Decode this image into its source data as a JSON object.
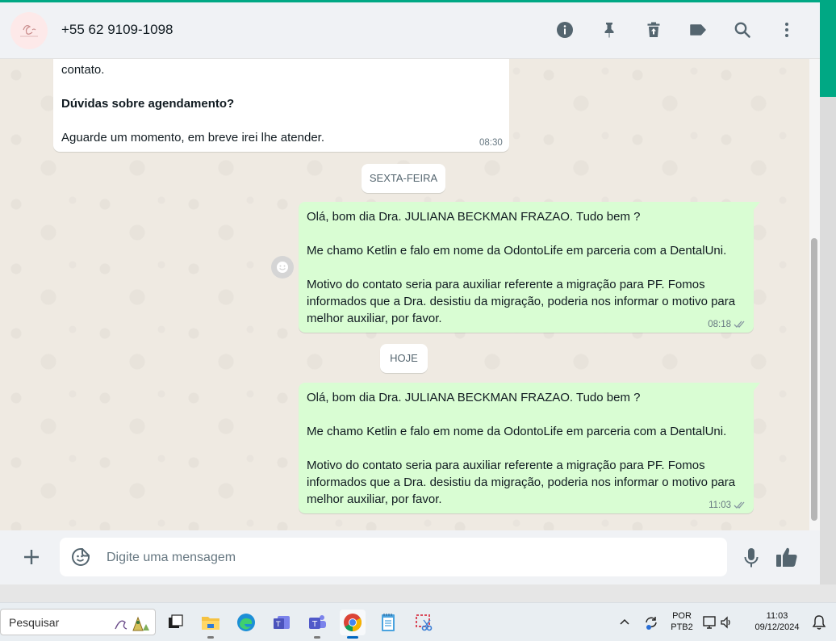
{
  "header": {
    "contact_name": "+55 62 9109-1098",
    "icons": [
      "info-icon",
      "pin-icon",
      "delete-icon",
      "label-icon",
      "search-icon",
      "menu-icon"
    ]
  },
  "messages": {
    "incoming_partial": {
      "line1": "contato.",
      "line2": "Dúvidas sobre agendamento?",
      "line3": "Aguarde um momento, em breve irei lhe atender.",
      "time": "08:30"
    },
    "date_friday": "SEXTA-FEIRA",
    "outgoing_1": {
      "p1": "Olá, bom dia Dra. JULIANA BECKMAN FRAZAO. Tudo bem ?",
      "p2": "Me chamo Ketlin e falo em nome da OdontoLife em parceria com a DentalUni.",
      "p3": "Motivo do contato seria para auxiliar referente a migração para PF. Fomos informados que a Dra. desistiu da migração, poderia nos informar o motivo para melhor auxiliar, por favor.",
      "time": "08:18"
    },
    "date_today": "HOJE",
    "outgoing_2": {
      "p1": "Olá, bom dia Dra. JULIANA BECKMAN FRAZAO. Tudo bem ?",
      "p2": "Me chamo Ketlin e falo em nome da OdontoLife em parceria com a DentalUni.",
      "p3": "Motivo do contato seria para auxiliar referente a migração para PF. Fomos informados que a Dra. desistiu da migração, poderia nos informar o motivo para melhor auxiliar, por favor.",
      "time": "11:03"
    }
  },
  "composer": {
    "placeholder": "Digite uma mensagem",
    "value": ""
  },
  "taskbar": {
    "search_label": "Pesquisar",
    "language_line1": "POR",
    "language_line2": "PTB2",
    "time": "11:03",
    "date": "09/12/2024"
  },
  "colors": {
    "accent": "#00a884",
    "outgoing_bubble": "#d9fdd3",
    "incoming_bubble": "#ffffff",
    "chat_bg": "#efeae2",
    "read_ticks": "#8696a0"
  }
}
